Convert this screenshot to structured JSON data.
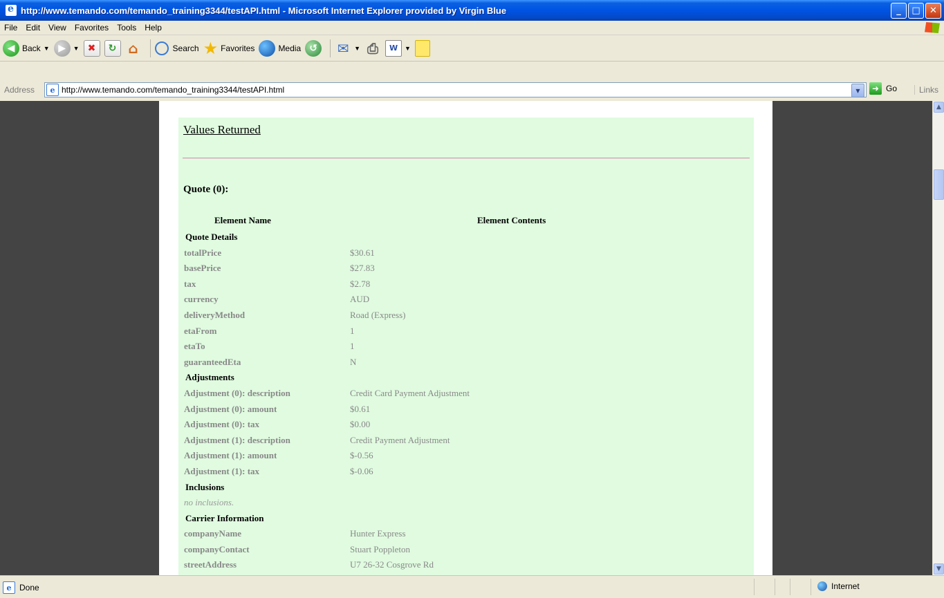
{
  "window": {
    "title": "http://www.temando.com/temando_training3344/testAPI.html - Microsoft Internet Explorer provided by Virgin Blue",
    "buttons": {
      "minimize": "_",
      "maximize": "□",
      "close": "✕"
    }
  },
  "menu": {
    "items": [
      "File",
      "Edit",
      "View",
      "Favorites",
      "Tools",
      "Help"
    ]
  },
  "toolbar": {
    "back_label": "Back",
    "search_label": "Search",
    "favorites_label": "Favorites",
    "media_label": "Media",
    "icons": [
      "back-icon",
      "forward-icon",
      "stop-icon",
      "refresh-icon",
      "home-icon",
      "search-icon",
      "favorites-icon",
      "media-icon",
      "history-icon",
      "mail-icon",
      "print-icon",
      "word-icon",
      "note-icon"
    ]
  },
  "address": {
    "label": "Address",
    "url": "http://www.temando.com/temando_training3344/testAPI.html",
    "go_label": "Go",
    "links_label": "Links"
  },
  "page": {
    "section_title": "Values Returned",
    "quote_title": "Quote (0):",
    "col_name": "Element Name",
    "col_contents": "Element Contents",
    "rows": [
      {
        "type": "section",
        "name": "Quote Details"
      },
      {
        "type": "item",
        "name": "totalPrice",
        "value": "$30.61"
      },
      {
        "type": "item",
        "name": "basePrice",
        "value": "$27.83"
      },
      {
        "type": "item",
        "name": "tax",
        "value": "$2.78"
      },
      {
        "type": "item",
        "name": "currency",
        "value": "AUD"
      },
      {
        "type": "item",
        "name": "deliveryMethod",
        "value": "Road (Express)"
      },
      {
        "type": "item",
        "name": "etaFrom",
        "value": "1"
      },
      {
        "type": "item",
        "name": "etaTo",
        "value": "1"
      },
      {
        "type": "item",
        "name": "guaranteedEta",
        "value": "N"
      },
      {
        "type": "section",
        "name": "Adjustments"
      },
      {
        "type": "item",
        "name": "Adjustment (0): description",
        "value": "Credit Card Payment Adjustment"
      },
      {
        "type": "item",
        "name": "Adjustment (0): amount",
        "value": "$0.61"
      },
      {
        "type": "item",
        "name": "Adjustment (0): tax",
        "value": "$0.00"
      },
      {
        "type": "item",
        "name": "Adjustment (1): description",
        "value": "Credit Payment Adjustment"
      },
      {
        "type": "item",
        "name": "Adjustment (1): amount",
        "value": "$-0.56"
      },
      {
        "type": "item",
        "name": "Adjustment (1): tax",
        "value": "$-0.06"
      },
      {
        "type": "section",
        "name": "Inclusions"
      },
      {
        "type": "note",
        "name": "no inclusions."
      },
      {
        "type": "section",
        "name": "Carrier Information"
      },
      {
        "type": "item",
        "name": "companyName",
        "value": "Hunter Express"
      },
      {
        "type": "item",
        "name": "companyContact",
        "value": "Stuart Poppleton"
      },
      {
        "type": "item",
        "name": "streetAddress",
        "value": "U7 26-32 Cosgrove Rd"
      }
    ]
  },
  "status": {
    "text": "Done",
    "zone": "Internet"
  },
  "colors": {
    "titlebar": "#0054e3",
    "page_bg": "#444444",
    "content_bg": "#e0fbe0",
    "muted_text": "#888888"
  }
}
